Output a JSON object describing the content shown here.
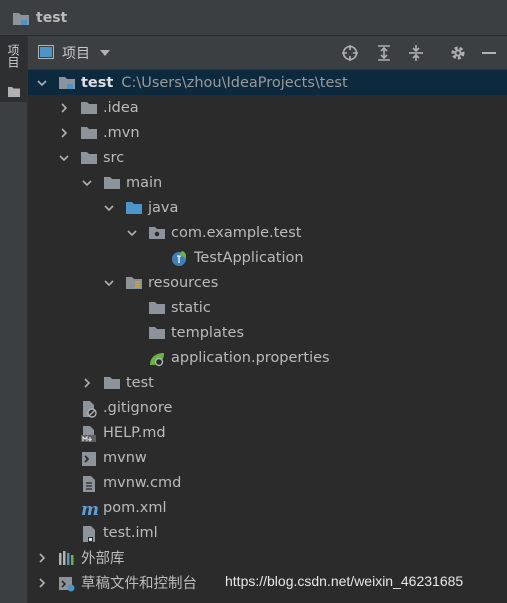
{
  "breadcrumb": {
    "title": "test"
  },
  "tool_window": {
    "stripe_label": "项目",
    "view_label": "项目"
  },
  "colors": {
    "selection": "#0d293e",
    "folder": "#8c939a",
    "source_folder": "#4b95c9",
    "background": "#2b2b2b"
  },
  "tree": [
    {
      "label": "test",
      "path": "C:\\Users\\zhou\\IdeaProjects\\test",
      "icon": "module-folder-icon",
      "expanded": true
    },
    {
      "label": ".idea",
      "icon": "folder-icon",
      "expanded": false
    },
    {
      "label": ".mvn",
      "icon": "folder-icon",
      "expanded": false
    },
    {
      "label": "src",
      "icon": "folder-icon",
      "expanded": true
    },
    {
      "label": "main",
      "icon": "folder-icon",
      "expanded": true
    },
    {
      "label": "java",
      "icon": "source-folder-icon",
      "expanded": true
    },
    {
      "label": "com.example.test",
      "icon": "package-icon",
      "expanded": true
    },
    {
      "label": "TestApplication",
      "icon": "spring-boot-class-icon"
    },
    {
      "label": "resources",
      "icon": "resources-folder-icon",
      "expanded": true
    },
    {
      "label": "static",
      "icon": "folder-icon"
    },
    {
      "label": "templates",
      "icon": "folder-icon"
    },
    {
      "label": "application.properties",
      "icon": "spring-properties-icon"
    },
    {
      "label": "test",
      "icon": "folder-icon",
      "expanded": false
    },
    {
      "label": ".gitignore",
      "icon": "gitignore-file-icon"
    },
    {
      "label": "HELP.md",
      "icon": "markdown-file-icon"
    },
    {
      "label": "mvnw",
      "icon": "shell-script-icon"
    },
    {
      "label": "mvnw.cmd",
      "icon": "text-file-icon"
    },
    {
      "label": "pom.xml",
      "icon": "maven-icon"
    },
    {
      "label": "test.iml",
      "icon": "iml-file-icon"
    },
    {
      "label": "外部库",
      "icon": "external-libraries-icon",
      "expanded": false
    },
    {
      "label": "草稿文件和控制台",
      "icon": "scratches-icon",
      "expanded": false
    }
  ],
  "watermark": "https://blog.csdn.net/weixin_46231685"
}
